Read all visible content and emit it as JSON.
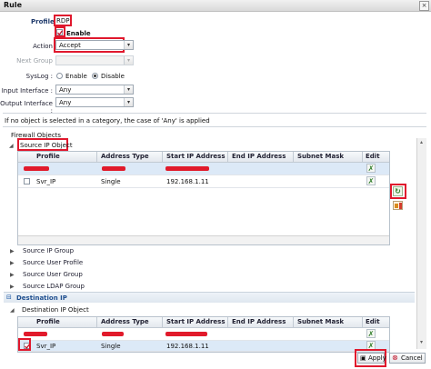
{
  "window": {
    "title": "Rule",
    "close_glyph": "×"
  },
  "form": {
    "profile_label": "Profile",
    "profile_value": "RDP",
    "enable_label": "Enable",
    "action_label": "Action",
    "action_value": "Accept",
    "next_group_label": "Next Group",
    "next_group_value": "",
    "syslog_label": "SysLog :",
    "syslog_enable": "Enable",
    "syslog_disable": "Disable",
    "input_interface_label": "Input Interface :",
    "input_interface_value": "Any",
    "output_interface_label": "Output Interface :",
    "output_interface_value": "Any",
    "note": "If no object is selected in a category, the case of 'Any' is applied"
  },
  "objects": {
    "header": "Firewall Objects",
    "source_ip_object": "Source IP Object",
    "columns": [
      "Profile",
      "Address Type",
      "Start IP Address",
      "End IP Address",
      "Subnet Mask",
      "Edit"
    ],
    "source_rows": [
      {
        "profile": "",
        "type": "",
        "start": "",
        "end": "",
        "mask": ""
      },
      {
        "profile": "Svr_IP",
        "type": "Single",
        "start": "192.168.1.11",
        "end": "",
        "mask": ""
      }
    ],
    "groups": [
      "Source IP Group",
      "Source User Profile",
      "Source User Group",
      "Source LDAP Group"
    ],
    "destination_ip": "Destination IP",
    "destination_ip_object": "Destination IP Object",
    "dest_rows": [
      {
        "profile": "",
        "type": "",
        "start": "",
        "end": "",
        "mask": ""
      },
      {
        "profile": "Svr_IP",
        "type": "Single",
        "start": "192.168.1.11",
        "end": "",
        "mask": ""
      }
    ]
  },
  "footer": {
    "apply": "Apply",
    "cancel": "Cancel"
  },
  "colors": {
    "highlight": "#e0182d",
    "accent": "#2a7a23"
  }
}
